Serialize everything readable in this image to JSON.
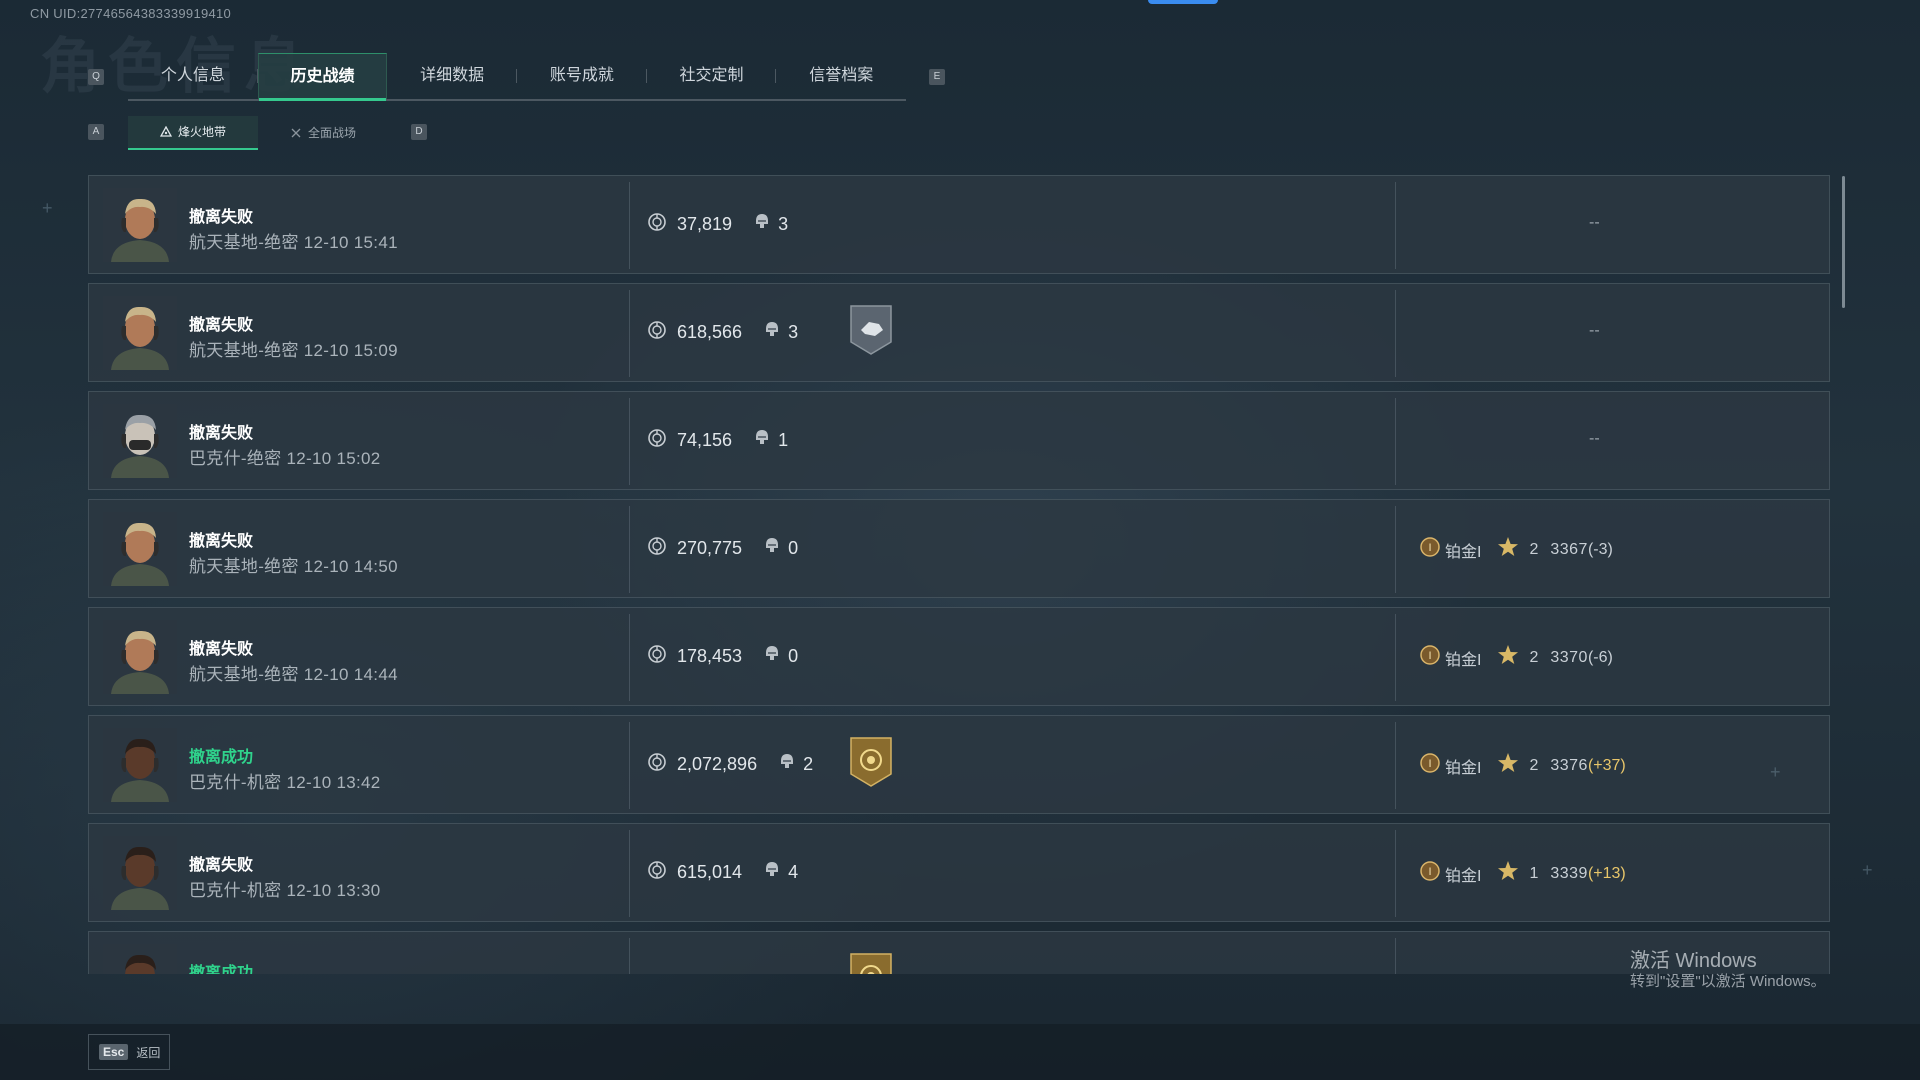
{
  "uid": "CN UID:27746564383339919410",
  "background_title": "角色信息",
  "tabs": {
    "prev_key": "Q",
    "next_key": "E",
    "items": [
      {
        "label": "个人信息"
      },
      {
        "label": "历史战绩",
        "active": true
      },
      {
        "label": "详细数据"
      },
      {
        "label": "账号成就"
      },
      {
        "label": "社交定制"
      },
      {
        "label": "信誉档案"
      }
    ]
  },
  "subtabs": {
    "prev_key": "A",
    "next_key": "D",
    "items": [
      {
        "label": "烽火地带",
        "active": true
      },
      {
        "label": "全面战场"
      }
    ]
  },
  "matches": [
    {
      "result": "撤离失败",
      "success": false,
      "map": "航天基地-绝密 12-10 15:41",
      "value": "37,819",
      "kills": "3",
      "badge": null,
      "rank": null,
      "dash": "--"
    },
    {
      "result": "撤离失败",
      "success": false,
      "map": "航天基地-绝密 12-10 15:09",
      "value": "618,566",
      "kills": "3",
      "badge": "silver-hand-badge",
      "rank": null,
      "dash": "--"
    },
    {
      "result": "撤离失败",
      "success": false,
      "map": "巴克什-绝密 12-10 15:02",
      "value": "74,156",
      "kills": "1",
      "badge": null,
      "rank": null,
      "dash": "--"
    },
    {
      "result": "撤离失败",
      "success": false,
      "map": "航天基地-绝密 12-10 14:50",
      "value": "270,775",
      "kills": "0",
      "badge": null,
      "rank": {
        "tier": "铂金I",
        "stars": "2",
        "score": "3367",
        "delta": "(-3)",
        "positive": false
      }
    },
    {
      "result": "撤离失败",
      "success": false,
      "map": "航天基地-绝密 12-10 14:44",
      "value": "178,453",
      "kills": "0",
      "badge": null,
      "rank": {
        "tier": "铂金I",
        "stars": "2",
        "score": "3370",
        "delta": "(-6)",
        "positive": false
      }
    },
    {
      "result": "撤离成功",
      "success": true,
      "map": "巴克什-机密 12-10 13:42",
      "value": "2,072,896",
      "kills": "2",
      "badge": "gold-coin-badge",
      "rank": {
        "tier": "铂金I",
        "stars": "2",
        "score": "3376",
        "delta": "(+37)",
        "positive": true
      }
    },
    {
      "result": "撤离失败",
      "success": false,
      "map": "巴克什-机密 12-10 13:30",
      "value": "615,014",
      "kills": "4",
      "badge": null,
      "rank": {
        "tier": "铂金I",
        "stars": "1",
        "score": "3339",
        "delta": "(+13)",
        "positive": true
      }
    },
    {
      "result": "撤离成功",
      "success": true,
      "map": "",
      "value": "",
      "kills": "",
      "badge": "gold-coin-badge",
      "rank": null,
      "dash": ""
    }
  ],
  "watermark": {
    "line1": "激活 Windows",
    "line2": "转到\"设置\"以激活 Windows。"
  },
  "footer": {
    "esc_key": "Esc",
    "back_label": "返回"
  },
  "colors": {
    "accent_green": "#35c98e",
    "success_text": "#2fd38c",
    "positive_delta": "#e8c66a"
  }
}
